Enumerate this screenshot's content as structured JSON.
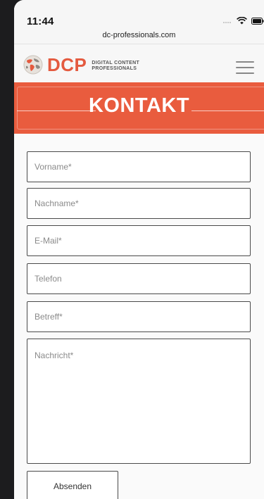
{
  "status_bar": {
    "time": "11:44",
    "url": "dc-professionals.com",
    "icons": [
      "signal-icon",
      "wifi-icon",
      "battery-icon"
    ]
  },
  "header": {
    "logo_text": "DCP",
    "logo_sub_line1": "DIGITAL CONTENT",
    "logo_sub_line2": "PROFESSIONALS",
    "menu_icon": "hamburger-menu-icon"
  },
  "banner": {
    "title": "KONTAKT"
  },
  "form": {
    "fields": [
      {
        "name": "vorname",
        "placeholder": "Vorname*"
      },
      {
        "name": "nachname",
        "placeholder": "Nachname*"
      },
      {
        "name": "email",
        "placeholder": "E-Mail*"
      },
      {
        "name": "telefon",
        "placeholder": "Telefon"
      },
      {
        "name": "betreff",
        "placeholder": "Betreff*"
      }
    ],
    "message_placeholder": "Nachricht*",
    "submit_label": "Absenden"
  },
  "colors": {
    "accent": "#e95c3e",
    "field_border": "#4a4a4a",
    "background": "#fafafa"
  }
}
